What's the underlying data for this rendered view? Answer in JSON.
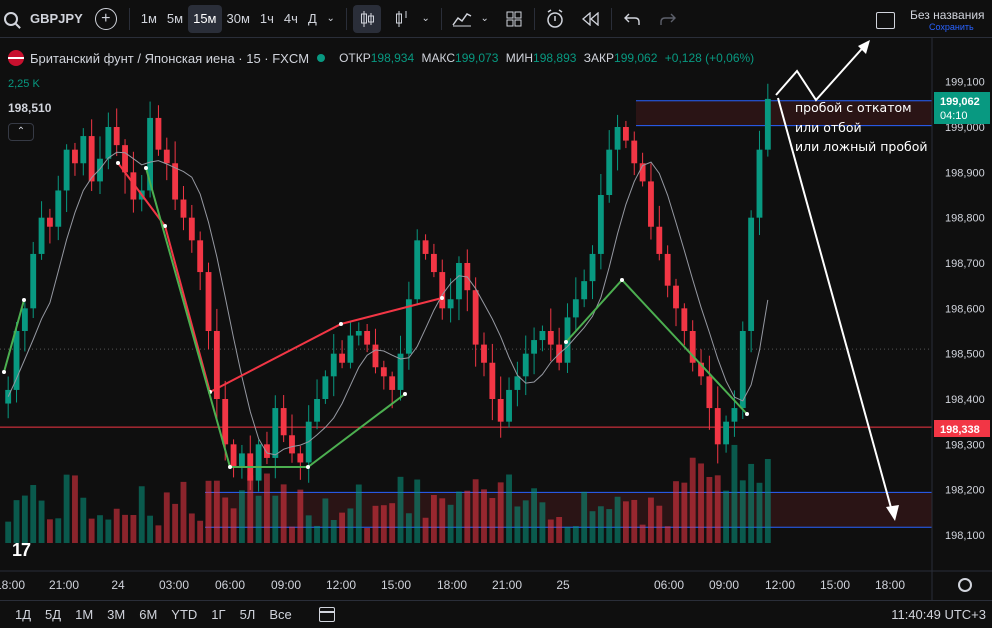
{
  "toolbar": {
    "symbol": "GBPJPY",
    "add": "+",
    "timeframes": [
      "1м",
      "5м",
      "15м",
      "30м",
      "1ч",
      "4ч",
      "Д"
    ],
    "active_timeframe": "15м",
    "icons": [
      "candles-icon",
      "indicators-icon",
      "templates-icon",
      "alert-icon",
      "replay-icon",
      "undo-icon",
      "redo-icon"
    ]
  },
  "layout": {
    "title": "Без названия",
    "save": "Сохранить"
  },
  "legend": {
    "name": "Британский фунт / Японская иена · 15 · FXCM",
    "open_label": "ОТКР",
    "open": "198,934",
    "high_label": "МАКС",
    "high": "199,073",
    "low_label": "МИН",
    "low": "198,893",
    "close_label": "ЗАКР",
    "close": "199,062",
    "change": "+0,128 (+0,06%)",
    "volume": "2,25 K",
    "crosshair_price": "198,510"
  },
  "annotation": [
    "пробой с откатом",
    "или отбой",
    "или ложный пробой"
  ],
  "bottom": {
    "ranges": [
      "1Д",
      "5Д",
      "1М",
      "3М",
      "6М",
      "YTD",
      "1Г",
      "5Л",
      "Все"
    ],
    "clock": "11:40:49 UTC+3"
  },
  "colors": {
    "up": "#089981",
    "down": "#f23645",
    "bg": "#0f0f0f",
    "level": "#f23645",
    "zone": "#2962ff"
  },
  "chart_data": {
    "type": "candlestick",
    "symbol": "GBPJPY",
    "interval": "15",
    "y_ticks": [
      199.1,
      199.0,
      198.9,
      198.8,
      198.7,
      198.6,
      198.5,
      198.4,
      198.3,
      198.2,
      198.1
    ],
    "y_tick_labels": [
      "199,100",
      "199,000",
      "198,900",
      "198,800",
      "198,700",
      "198,600",
      "198,500",
      "198,400",
      "198,300",
      "198,200",
      "198,100"
    ],
    "ylim": [
      198.04,
      199.17
    ],
    "x_tick_labels": [
      "18:00",
      "21:00",
      "24",
      "03:00",
      "06:00",
      "09:00",
      "12:00",
      "15:00",
      "18:00",
      "21:00",
      "25",
      "06:00",
      "09:00",
      "12:00",
      "15:00",
      "18:00"
    ],
    "price_label": {
      "value": "199,062",
      "countdown": "04:10"
    },
    "level_label": "198,338",
    "levels": {
      "red_line": 198.338,
      "crosshair": 198.51,
      "zone_top": [
        199.058,
        199.003
      ],
      "zone_bottom": [
        198.194,
        198.117
      ]
    },
    "candles_close": [
      198.42,
      198.55,
      198.6,
      198.72,
      198.8,
      198.78,
      198.86,
      198.95,
      198.92,
      198.98,
      198.88,
      198.93,
      199.0,
      198.96,
      198.9,
      198.84,
      198.86,
      199.02,
      198.95,
      198.92,
      198.84,
      198.8,
      198.75,
      198.68,
      198.55,
      198.4,
      198.3,
      198.25,
      198.28,
      198.22,
      198.3,
      198.27,
      198.38,
      198.32,
      198.28,
      198.26,
      198.35,
      198.4,
      198.45,
      198.5,
      198.48,
      198.54,
      198.55,
      198.52,
      198.47,
      198.45,
      198.42,
      198.5,
      198.62,
      198.75,
      198.72,
      198.68,
      198.6,
      198.62,
      198.7,
      198.64,
      198.52,
      198.48,
      198.4,
      198.35,
      198.42,
      198.45,
      198.5,
      198.53,
      198.55,
      198.52,
      198.48,
      198.58,
      198.62,
      198.66,
      198.72,
      198.85,
      198.95,
      199.0,
      198.97,
      198.92,
      198.88,
      198.78,
      198.72,
      198.65,
      198.6,
      198.55,
      198.48,
      198.45,
      198.38,
      198.3,
      198.35,
      198.38,
      198.55,
      198.8,
      198.95,
      199.062
    ],
    "wave_lines": [
      {
        "color": "red",
        "points": [
          [
            "21:00",
            198.92
          ],
          [
            "24 03:00",
            198.79
          ],
          [
            "04:30",
            198.41
          ],
          [
            "12:00",
            198.57
          ],
          [
            "17:30",
            198.63
          ]
        ]
      },
      {
        "color": "green",
        "points": [
          [
            "24 01:00",
            198.91
          ],
          [
            "05:30",
            198.25
          ],
          [
            "10:00",
            198.25
          ],
          [
            "16:00",
            198.41
          ]
        ]
      },
      {
        "color": "green",
        "points": [
          [
            "25 00:00",
            198.53
          ],
          [
            "04:30",
            198.66
          ],
          [
            "10:00",
            198.37
          ]
        ]
      }
    ]
  }
}
